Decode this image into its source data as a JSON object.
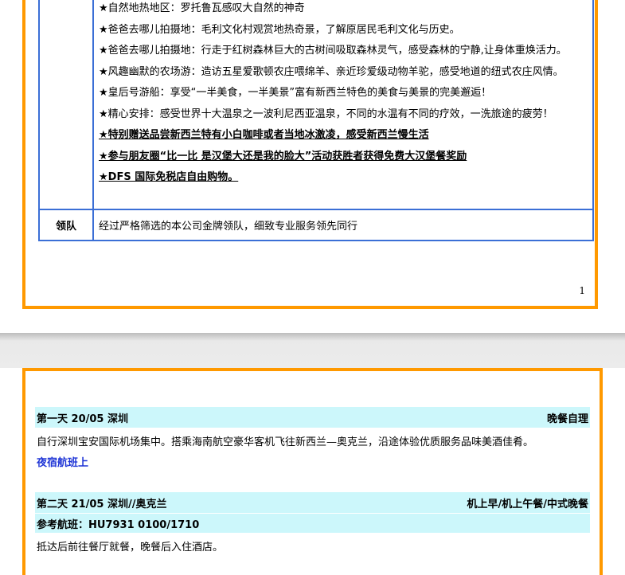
{
  "highlights": [
    "★自然地热地区：罗托鲁瓦感叹大自然的神奇",
    "★爸爸去哪儿拍摄地：毛利文化村观赏地热奇景，了解原居民毛利文化与历史。",
    "★爸爸去哪儿拍摄地：行走于红树森林巨大的古树间吸取森林灵气，感受森林的宁静,让身体重焕活力。",
    "★风趣幽默的农场游：造访五星爱歌顿农庄喂绵羊、亲近珍爱级动物羊驼，感受地道的纽式农庄风情。",
    "★皇后号游船：享受“一半美食，一半美景”富有新西兰特色的美食与美景的完美邂逅！",
    "★精心安排：感受世界十大温泉之一波利尼西亚温泉，不同的水温有不同的疗效，一洗旅途的疲劳！"
  ],
  "highlights_bold": [
    "★特别赠送品尝新西兰特有小白咖啡或者当地冰激凌，感受新西兰慢生活",
    "★参与朋友圈“比一比 是汉堡大还是我的脸大”活动获胜者获得免费大汉堡餐奖励",
    "★DFS 国际免税店自由购物。"
  ],
  "leader": {
    "label": "领队",
    "text": "经过严格筛选的本公司金牌领队，细致专业服务领先同行"
  },
  "page_number": "1",
  "day1": {
    "title": "第一天 20/05  深圳",
    "meals": "晚餐自理",
    "desc": "自行深圳宝安国际机场集中。搭乘海南航空豪华客机飞往新西兰—奥克兰，沿途体验优质服务品味美酒佳肴。",
    "night": "夜宿航班上"
  },
  "day2": {
    "title": "第二天 21/05  深圳//奥克兰",
    "meals": "机上早/机上午餐/中式晚餐",
    "flight": "参考航班：HU7931    0100/1710",
    "desc": "抵达后前往餐厅就餐，晚餐后入住酒店。"
  },
  "colors": {
    "page_border": "#ff9900",
    "table_border": "#3b6fd6",
    "day_header_bg": "#ccf7fb",
    "night_text": "#1f35d6"
  }
}
